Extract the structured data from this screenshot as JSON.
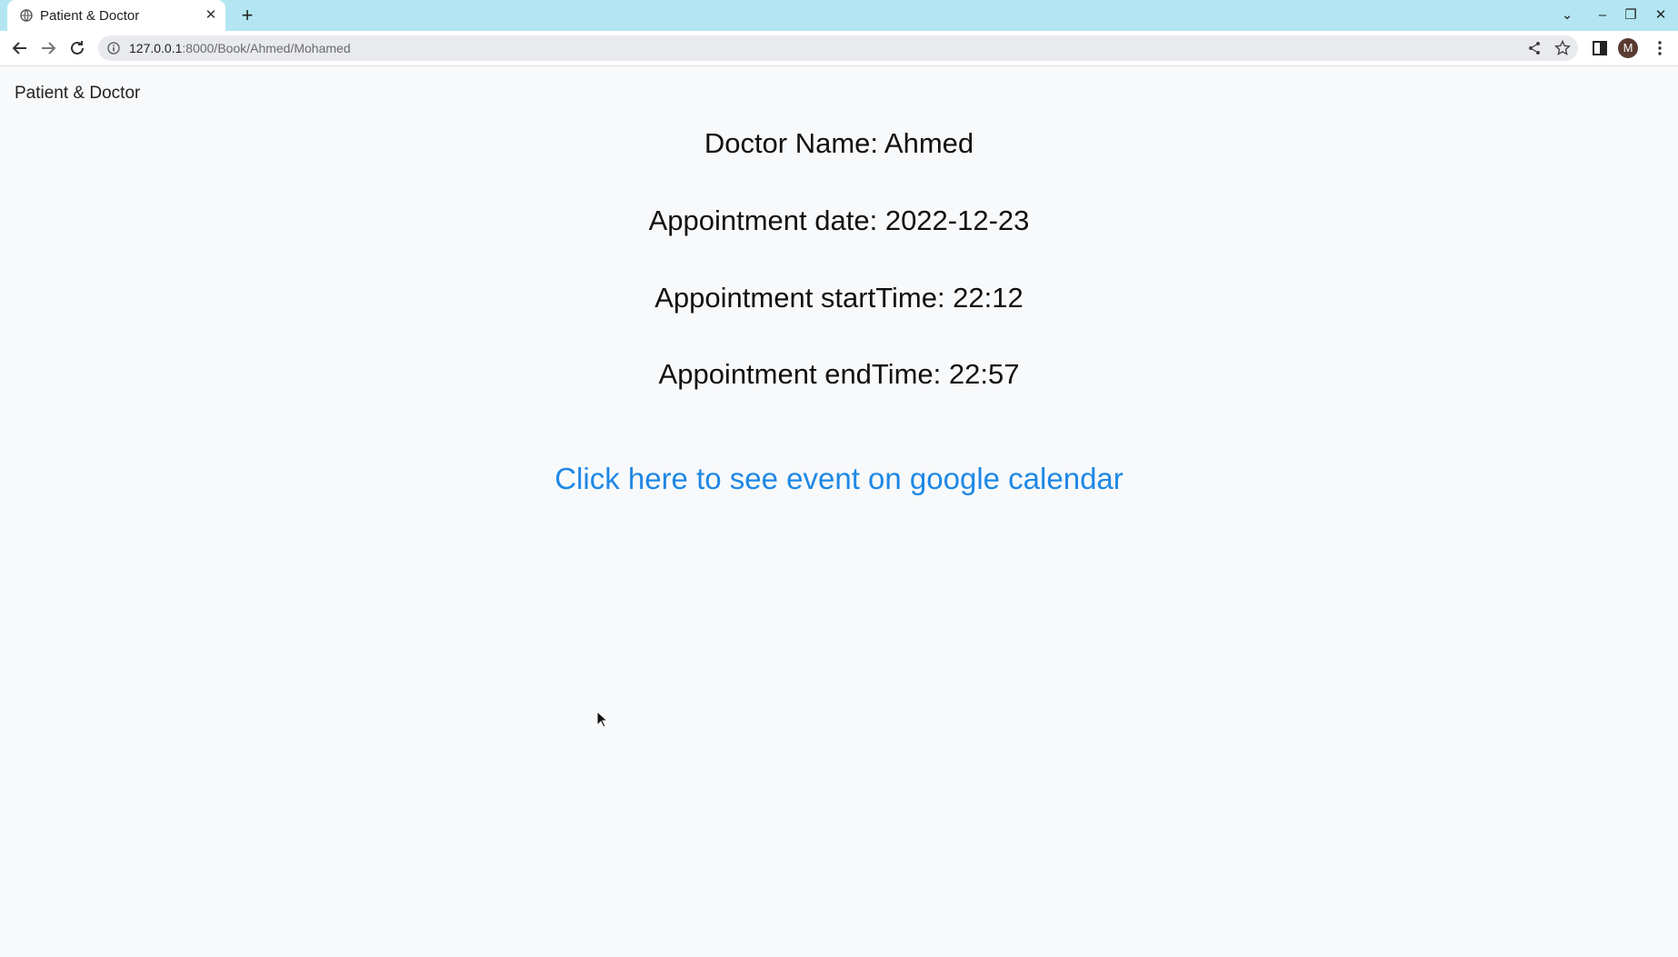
{
  "browser": {
    "tab": {
      "title": "Patient & Doctor",
      "close_glyph": "✕"
    },
    "new_tab_glyph": "+",
    "window_controls": {
      "dropdown": "⌄",
      "minimize": "–",
      "restore": "❐",
      "close": "✕"
    },
    "address": {
      "host": "127.0.0.1",
      "rest": ":8000/Book/Ahmed/Mohamed"
    },
    "profile_initial": "M"
  },
  "page": {
    "brand": "Patient & Doctor",
    "doctor_name": "Doctor Name: Ahmed",
    "appointment_date": "Appointment date: 2022-12-23",
    "start_time": "Appointment startTime: 22:12",
    "end_time": "Appointment endTime: 22:57",
    "calendar_link": "Click here to see event on google calendar"
  },
  "colors": {
    "tabstrip": "#b3e6f2",
    "page_bg": "#f8f9fb",
    "link": "#1e88e5"
  },
  "icons": [
    "globe-icon",
    "close-icon",
    "plus-icon",
    "back-icon",
    "forward-icon",
    "reload-icon",
    "info-icon",
    "share-icon",
    "star-icon",
    "side-panel-icon",
    "menu-icon"
  ]
}
